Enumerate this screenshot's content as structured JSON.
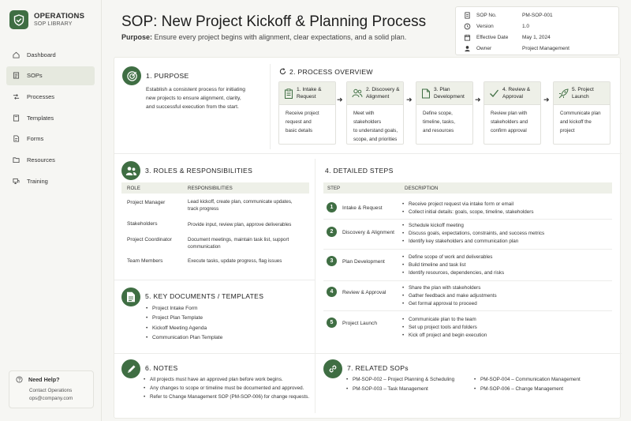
{
  "brand": {
    "title": "OPERATIONS",
    "subtitle": "SOP LIBRARY"
  },
  "nav": [
    {
      "label": "Dashboard",
      "icon": "home-icon",
      "active": false
    },
    {
      "label": "SOPs",
      "icon": "document-icon",
      "active": true
    },
    {
      "label": "Processes",
      "icon": "flow-icon",
      "active": false
    },
    {
      "label": "Templates",
      "icon": "template-icon",
      "active": false
    },
    {
      "label": "Forms",
      "icon": "form-icon",
      "active": false
    },
    {
      "label": "Resources",
      "icon": "folder-icon",
      "active": false
    },
    {
      "label": "Training",
      "icon": "training-icon",
      "active": false
    }
  ],
  "help": {
    "title": "Need Help?",
    "line1": "Contact Operations",
    "line2": "ops@company.com"
  },
  "header": {
    "title": "SOP: New Project Kickoff & Planning Process",
    "purpose_label": "Purpose:",
    "purpose_text": " Ensure every project begins with alignment, clear expectations, and a solid plan."
  },
  "meta": [
    {
      "key": "SOP No.",
      "value": "PM-SOP-001",
      "icon": "document-icon"
    },
    {
      "key": "Version",
      "value": "1.0",
      "icon": "clock-icon"
    },
    {
      "key": "Effective Date",
      "value": "May 1, 2024",
      "icon": "calendar-icon"
    },
    {
      "key": "Owner",
      "value": "Project Management",
      "icon": "user-icon"
    }
  ],
  "purpose": {
    "title": "1.  PURPOSE",
    "lines": [
      "Establish a consistent process for initiating",
      "new projects to ensure alignment, clarity,",
      "and successful execution from the start."
    ]
  },
  "overview": {
    "title": "2.  PROCESS OVERVIEW",
    "steps": [
      {
        "label1": "1. Intake &",
        "label2": "Request",
        "icon": "clipboard-icon",
        "desc": [
          "Receive project",
          "request and",
          "basic details"
        ]
      },
      {
        "label1": "2. Discovery &",
        "label2": "Alignment",
        "icon": "people-icon",
        "desc": [
          "Meet with stakeholders",
          "to understand goals,",
          "scope, and priorities"
        ]
      },
      {
        "label1": "3. Plan",
        "label2": "Development",
        "icon": "plan-icon",
        "desc": [
          "Define scope,",
          "timeline, tasks,",
          "and resources"
        ]
      },
      {
        "label1": "4. Review &",
        "label2": "Approval",
        "icon": "check-icon",
        "desc": [
          "Review plan with",
          "stakeholders and",
          "confirm approval"
        ]
      },
      {
        "label1": "5. Project",
        "label2": "Launch",
        "icon": "rocket-icon",
        "desc": [
          "Communicate plan",
          "and kickoff the",
          "project"
        ]
      }
    ]
  },
  "roles": {
    "title": "3.  ROLES & RESPONSIBILITIES",
    "col_role": "ROLE",
    "col_resp": "RESPONSIBILITIES",
    "rows": [
      {
        "role": "Project Manager",
        "resp": [
          "Lead kickoff, create plan, communicate updates,",
          "track progress"
        ]
      },
      {
        "role": "Stakeholders",
        "resp": [
          "Provide input, review plan, approve deliverables"
        ]
      },
      {
        "role": "Project Coordinator",
        "resp": [
          "Document meetings, maintain task list, support",
          "communication"
        ]
      },
      {
        "role": "Team Members",
        "resp": [
          "Execute tasks, update progress, flag issues"
        ]
      }
    ]
  },
  "steps": {
    "title": "4.  DETAILED STEPS",
    "col_step": "STEP",
    "col_desc": "DESCRIPTION",
    "rows": [
      {
        "num": "1",
        "name": "Intake & Request",
        "items": [
          "Receive project request via intake form or email",
          "Collect initial details: goals, scope, timeline, stakeholders"
        ]
      },
      {
        "num": "2",
        "name": "Discovery & Alignment",
        "items": [
          "Schedule kickoff meeting",
          "Discuss goals, expectations, constraints, and success metrics",
          "Identify key stakeholders and communication plan"
        ]
      },
      {
        "num": "3",
        "name": "Plan Development",
        "items": [
          "Define scope of work and deliverables",
          "Build timeline and task list",
          "Identify resources, dependencies, and risks"
        ]
      },
      {
        "num": "4",
        "name": "Review & Approval",
        "items": [
          "Share the plan with stakeholders",
          "Gather feedback and make adjustments",
          "Get formal approval to proceed"
        ]
      },
      {
        "num": "5",
        "name": "Project Launch",
        "items": [
          "Communicate plan to the team",
          "Set up project tools and folders",
          "Kick off project and begin execution"
        ]
      }
    ]
  },
  "documents": {
    "title": "5.  KEY DOCUMENTS / TEMPLATES",
    "items": [
      "Project Intake Form",
      "Project Plan Template",
      "Kickoff Meeting Agenda",
      "Communication Plan Template"
    ]
  },
  "notes": {
    "title": "6.  NOTES",
    "items": [
      "All projects must have an approved plan before work begins.",
      "Any changes to scope or timeline must be documented and approved.",
      "Refer to Change Management SOP (PM-SOP-006) for change requests."
    ]
  },
  "related": {
    "title": "7.  RELATED SOPs",
    "left": [
      "PM-SOP-002 – Project Planning & Scheduling",
      "PM-SOP-003 – Task Management"
    ],
    "right": [
      "PM-SOP-004 – Communication Management",
      "PM-SOP-006 – Change Management"
    ]
  },
  "colors": {
    "accent": "#3f6e43",
    "header_fill": "#eef0e8",
    "active_nav": "#e6e9df"
  }
}
